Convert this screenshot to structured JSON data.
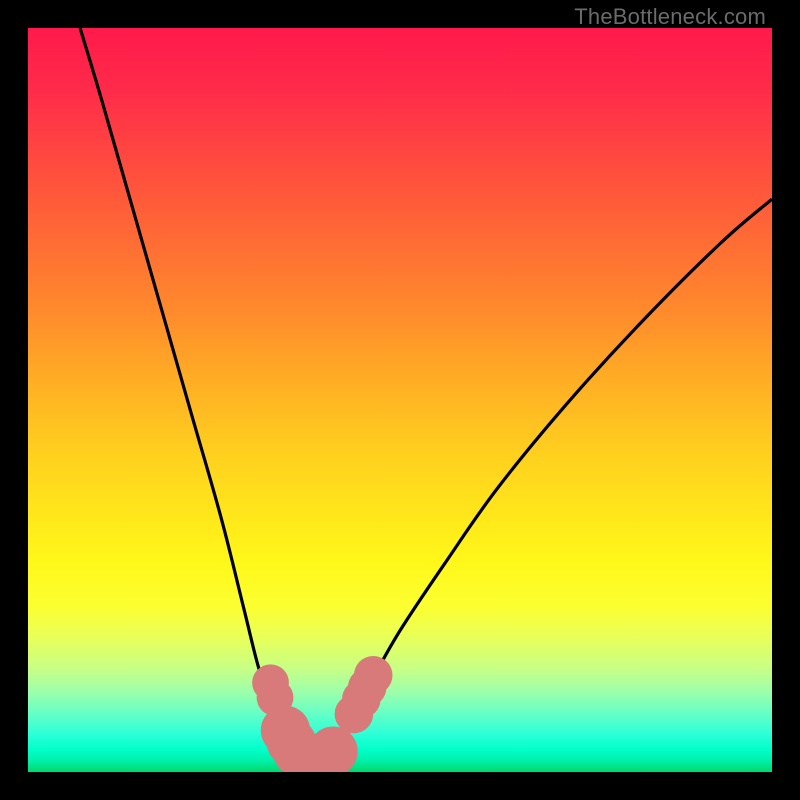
{
  "attribution": "TheBottleneck.com",
  "colors": {
    "frame": "#000000",
    "curve": "#000000",
    "markers_fill": "#d87a7a",
    "markers_stroke": "#b85a5a"
  },
  "chart_data": {
    "type": "line",
    "title": "",
    "xlabel": "",
    "ylabel": "",
    "xlim": [
      0,
      100
    ],
    "ylim": [
      0,
      100
    ],
    "grid": false,
    "series": [
      {
        "name": "bottleneck-curve-left",
        "x": [
          7,
          10,
          14,
          18,
          22,
          26,
          29,
          31,
          33,
          34.5,
          36,
          37.5
        ],
        "y": [
          100,
          90,
          76,
          62,
          48,
          34,
          22,
          14,
          8,
          4.5,
          2,
          1
        ]
      },
      {
        "name": "bottleneck-curve-right",
        "x": [
          37.5,
          39,
          41,
          43,
          46,
          50,
          56,
          63,
          72,
          82,
          93,
          100
        ],
        "y": [
          1,
          2,
          4,
          7,
          12,
          19,
          28,
          38,
          49,
          60,
          71,
          77
        ]
      }
    ],
    "markers": [
      {
        "x": 32.6,
        "y": 12.0,
        "r": 1.5
      },
      {
        "x": 33.2,
        "y": 10.0,
        "r": 1.5
      },
      {
        "x": 34.6,
        "y": 5.6,
        "r": 2.2
      },
      {
        "x": 35.4,
        "y": 4.0,
        "r": 2.2
      },
      {
        "x": 36.2,
        "y": 2.8,
        "r": 2.2
      },
      {
        "x": 37.0,
        "y": 2.0,
        "r": 2.2
      },
      {
        "x": 38.0,
        "y": 1.6,
        "r": 2.2
      },
      {
        "x": 39.0,
        "y": 1.6,
        "r": 2.2
      },
      {
        "x": 40.0,
        "y": 2.0,
        "r": 2.2
      },
      {
        "x": 41.0,
        "y": 2.8,
        "r": 2.2
      },
      {
        "x": 43.8,
        "y": 7.8,
        "r": 1.6
      },
      {
        "x": 44.8,
        "y": 9.8,
        "r": 1.6
      },
      {
        "x": 45.6,
        "y": 11.4,
        "r": 1.6
      },
      {
        "x": 46.4,
        "y": 13.0,
        "r": 1.6
      }
    ]
  }
}
